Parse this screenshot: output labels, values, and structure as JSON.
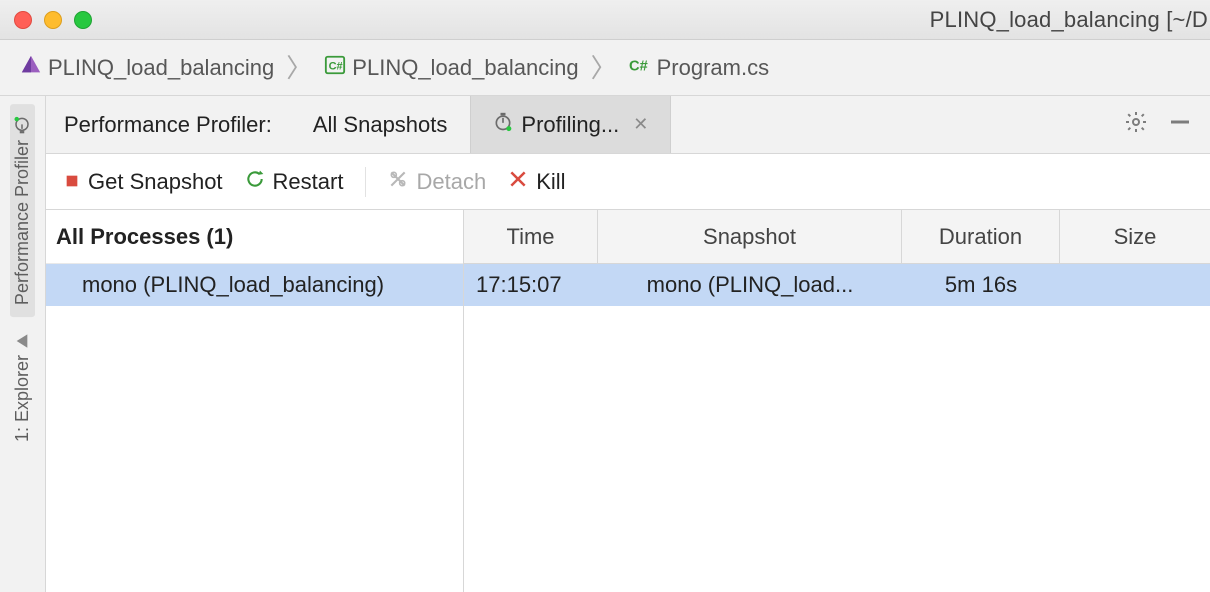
{
  "window": {
    "title": "PLINQ_load_balancing [~/D"
  },
  "breadcrumb": {
    "items": [
      {
        "label": "PLINQ_load_balancing"
      },
      {
        "label": "PLINQ_load_balancing"
      },
      {
        "label": "Program.cs"
      }
    ]
  },
  "sidebar": {
    "profiler_label": "Performance Profiler",
    "explorer_label": "1: Explorer"
  },
  "profiler_tabs": {
    "label": "Performance Profiler:",
    "all_snapshots": "All Snapshots",
    "profiling": "Profiling..."
  },
  "toolbar": {
    "get_snapshot": "Get Snapshot",
    "restart": "Restart",
    "detach": "Detach",
    "kill": "Kill"
  },
  "processes": {
    "header": "All Processes (1)",
    "items": [
      {
        "label": "mono (PLINQ_load_balancing)"
      }
    ]
  },
  "table": {
    "headers": {
      "time": "Time",
      "snapshot": "Snapshot",
      "duration": "Duration",
      "size": "Size"
    },
    "rows": [
      {
        "time": "17:15:07",
        "snapshot": "mono (PLINQ_load...",
        "duration": "5m 16s",
        "size": ""
      }
    ]
  }
}
